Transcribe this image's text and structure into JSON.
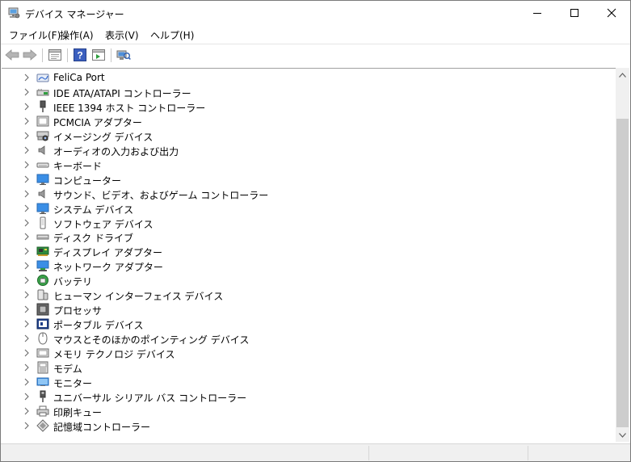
{
  "window": {
    "title": "デバイス マネージャー",
    "icon": "device-manager-icon"
  },
  "menu": [
    {
      "label": "ファイル(F)"
    },
    {
      "label": "操作(A)"
    },
    {
      "label": "表示(V)"
    },
    {
      "label": "ヘルプ(H)"
    }
  ],
  "toolbar": {
    "buttons": [
      "back-arrow-icon",
      "forward-arrow-icon",
      "properties-icon",
      "help-icon",
      "show-hidden-icon",
      "scan-hardware-icon"
    ]
  },
  "tree": {
    "items": [
      {
        "label": "FeliCa Port",
        "icon": "felica-icon"
      },
      {
        "label": "IDE ATA/ATAPI コントローラー",
        "icon": "ide-controller-icon"
      },
      {
        "label": "IEEE 1394 ホスト コントローラー",
        "icon": "ieee1394-icon"
      },
      {
        "label": "PCMCIA アダプター",
        "icon": "pcmcia-icon"
      },
      {
        "label": "イメージング デバイス",
        "icon": "imaging-device-icon"
      },
      {
        "label": "オーディオの入力および出力",
        "icon": "speaker-icon"
      },
      {
        "label": "キーボード",
        "icon": "keyboard-icon"
      },
      {
        "label": "コンピューター",
        "icon": "computer-icon"
      },
      {
        "label": "サウンド、ビデオ、およびゲーム コントローラー",
        "icon": "sound-icon"
      },
      {
        "label": "システム デバイス",
        "icon": "system-device-icon"
      },
      {
        "label": "ソフトウェア デバイス",
        "icon": "software-device-icon"
      },
      {
        "label": "ディスク ドライブ",
        "icon": "disk-drive-icon"
      },
      {
        "label": "ディスプレイ アダプター",
        "icon": "display-adapter-icon"
      },
      {
        "label": "ネットワーク アダプター",
        "icon": "network-adapter-icon"
      },
      {
        "label": "バッテリ",
        "icon": "battery-icon"
      },
      {
        "label": "ヒューマン インターフェイス デバイス",
        "icon": "hid-icon"
      },
      {
        "label": "プロセッサ",
        "icon": "processor-icon"
      },
      {
        "label": "ポータブル デバイス",
        "icon": "portable-device-icon"
      },
      {
        "label": "マウスとそのほかのポインティング デバイス",
        "icon": "mouse-icon"
      },
      {
        "label": "メモリ テクノロジ デバイス",
        "icon": "memory-technology-icon"
      },
      {
        "label": "モデム",
        "icon": "modem-icon"
      },
      {
        "label": "モニター",
        "icon": "monitor-icon"
      },
      {
        "label": "ユニバーサル シリアル バス コントローラー",
        "icon": "usb-icon"
      },
      {
        "label": "印刷キュー",
        "icon": "printer-icon"
      },
      {
        "label": "記憶域コントローラー",
        "icon": "storage-controller-icon"
      }
    ]
  },
  "colors": {
    "accent": "#1e90ff",
    "monitor_blue": "#3a8ee6"
  }
}
